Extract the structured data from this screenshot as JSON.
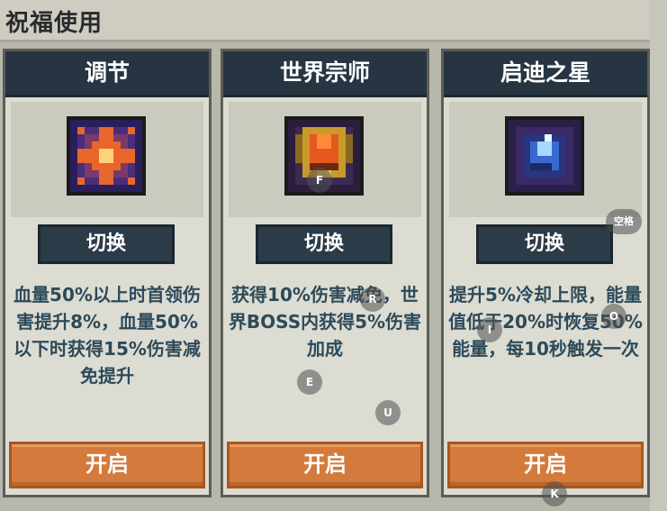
{
  "header": {
    "title": "祝福使用"
  },
  "cards": [
    {
      "title": "调节",
      "icon": "radiant-star-icon",
      "switch_label": "切换",
      "description": "血量50%以上时首领伤害提升8%，血量50%以下时获得15%伤害减免提升",
      "open_label": "开启"
    },
    {
      "title": "世界宗师",
      "icon": "golden-trophy-icon",
      "switch_label": "切换",
      "description": "获得10%伤害减免，世界BOSS内获得5%伤害加成",
      "open_label": "开启"
    },
    {
      "title": "启迪之星",
      "icon": "blue-crystal-icon",
      "switch_label": "切换",
      "description": "提升5%冷却上限，能量值低于20%时恢复50%能量，每10秒触发一次",
      "open_label": "开启"
    }
  ],
  "key_hints": [
    "F",
    "R",
    "E",
    "U",
    "I",
    "O",
    "空格",
    "K"
  ],
  "colors": {
    "header_bg": "#263541",
    "open_button": "#d47a3c",
    "desc_text": "#2d4a5a"
  }
}
